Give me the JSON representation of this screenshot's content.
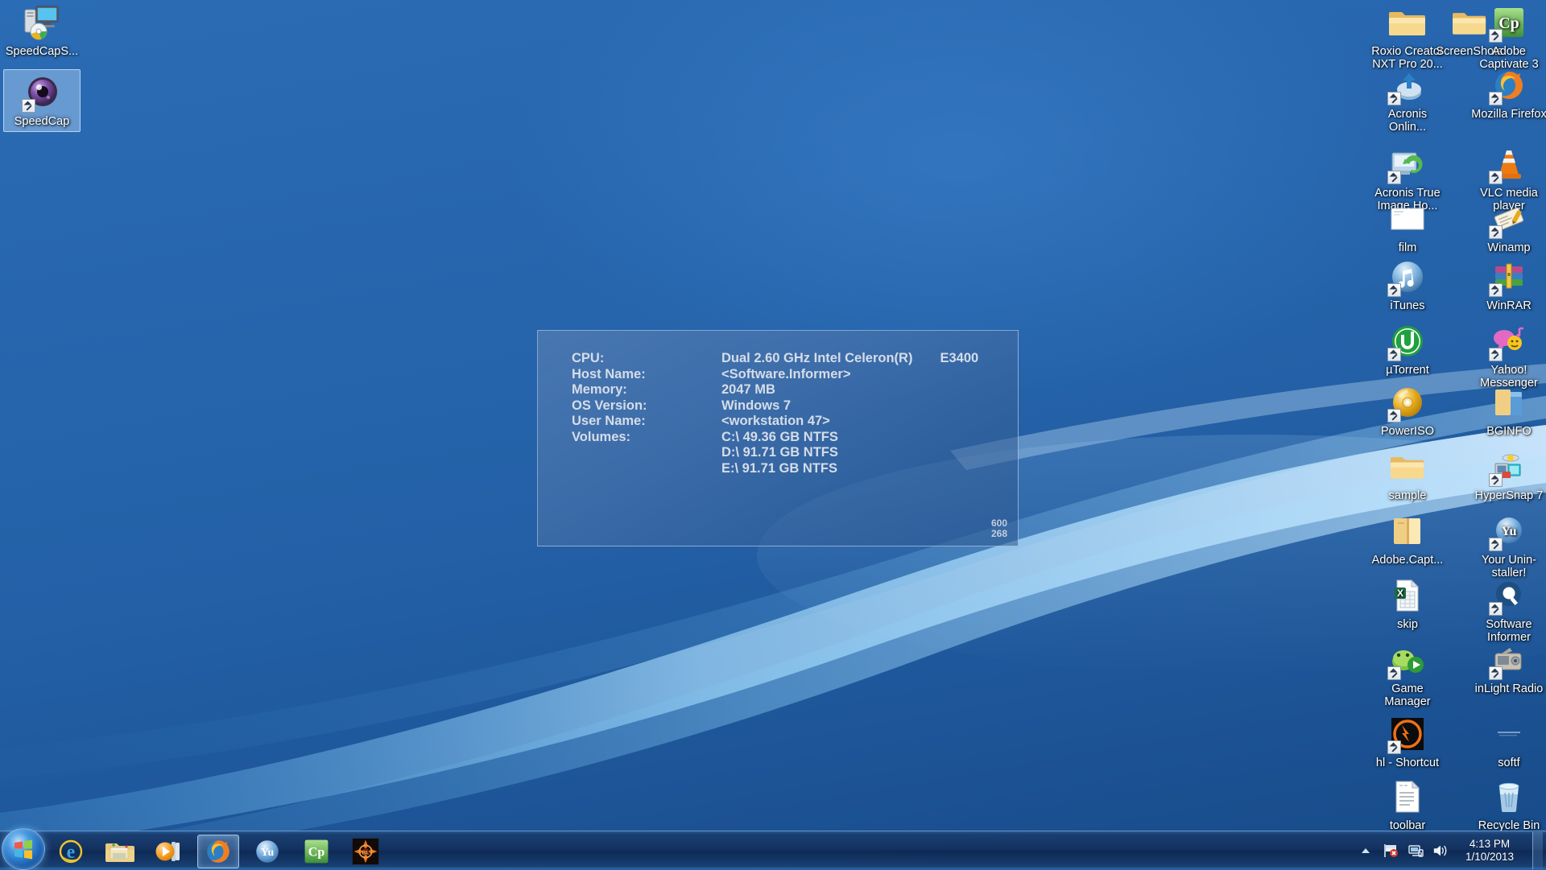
{
  "desktop": {
    "wallpaper_name": "windows-7-harmony-blue",
    "colors": {
      "wallpaper_top": "#2a6cb5",
      "wallpaper_bottom": "#174a87",
      "taskbar": "#12305e",
      "selection": "#b4d4f5",
      "bginfo_text": "#d6dde8"
    },
    "icons_left": [
      {
        "name": "SpeedCapS...",
        "icon": "computer-media-icon",
        "selected": false,
        "shortcut": false
      },
      {
        "name": "SpeedCap",
        "icon": "camera-lens-icon",
        "selected": true,
        "shortcut": true
      }
    ],
    "icons_right_col1": [
      {
        "name": "Roxio Creator NXT Pro 20...",
        "icon": "folder-icon",
        "shortcut": false
      },
      {
        "name": "Acronis Onlin...",
        "icon": "acronis-backup-icon",
        "shortcut": true
      },
      {
        "name": "Acronis True Image Ho...",
        "icon": "acronis-true-image-icon",
        "shortcut": true
      },
      {
        "name": "film",
        "icon": "blank-document-icon",
        "shortcut": false
      },
      {
        "name": "iTunes",
        "icon": "itunes-icon",
        "shortcut": true
      },
      {
        "name": "µTorrent",
        "icon": "utorrent-icon",
        "shortcut": true
      },
      {
        "name": "PowerISO",
        "icon": "disc-icon",
        "shortcut": true
      },
      {
        "name": "sample",
        "icon": "folder-icon",
        "shortcut": false
      },
      {
        "name": "Adobe.Capt...",
        "icon": "folder-open-icon",
        "shortcut": false
      },
      {
        "name": "skip",
        "icon": "excel-document-icon",
        "shortcut": false
      },
      {
        "name": "Game Manager",
        "icon": "game-manager-icon",
        "shortcut": true
      },
      {
        "name": "hl - Shortcut",
        "icon": "half-life-icon",
        "shortcut": true
      },
      {
        "name": "toolbar",
        "icon": "text-document-icon",
        "shortcut": false
      }
    ],
    "icons_right_col2": [
      {
        "name": "ScreenShots",
        "icon": "folder-icon",
        "shortcut": false
      },
      {
        "name": "Adobe Captivate 3",
        "icon": "adobe-captivate-icon",
        "shortcut": true
      },
      {
        "name": "Mozilla Firefox",
        "icon": "firefox-icon",
        "shortcut": true
      },
      {
        "name": "VLC media player",
        "icon": "vlc-cone-icon",
        "shortcut": true
      },
      {
        "name": "Winamp",
        "icon": "winamp-icon",
        "shortcut": true
      },
      {
        "name": "WinRAR",
        "icon": "winrar-icon",
        "shortcut": true
      },
      {
        "name": "Yahoo! Messenger",
        "icon": "yahoo-messenger-icon",
        "shortcut": true
      },
      {
        "name": "BGINFO",
        "icon": "folder-blue-icon",
        "shortcut": false
      },
      {
        "name": "HyperSnap 7",
        "icon": "hypersnap-icon",
        "shortcut": true
      },
      {
        "name": "Your Unin-staller!",
        "icon": "your-uninstaller-icon",
        "shortcut": true
      },
      {
        "name": "Software Informer",
        "icon": "software-informer-icon",
        "shortcut": true
      },
      {
        "name": "inLight Radio",
        "icon": "inlight-radio-icon",
        "shortcut": true
      },
      {
        "name": "softf",
        "icon": "unknown-icon",
        "shortcut": false
      },
      {
        "name": "Recycle Bin",
        "icon": "recycle-bin-icon",
        "shortcut": false
      }
    ]
  },
  "bginfo": {
    "rows": [
      {
        "label": "CPU:",
        "value": "Dual 2.60 GHz Intel Celeron(R)",
        "value2": "E3400"
      },
      {
        "label": "Host Name:",
        "value": "<Software.Informer>",
        "value2": ""
      },
      {
        "label": "Memory:",
        "value": "2047 MB",
        "value2": ""
      },
      {
        "label": "OS Version:",
        "value": "Windows 7",
        "value2": ""
      },
      {
        "label": "User Name:",
        "value": "<workstation 47>",
        "value2": ""
      },
      {
        "label": "Volumes:",
        "value": "C:\\ 49.36 GB NTFS",
        "value2": ""
      },
      {
        "label": "",
        "value": "D:\\ 91.71 GB NTFS",
        "value2": ""
      },
      {
        "label": "",
        "value": "E:\\ 91.71 GB NTFS",
        "value2": ""
      }
    ],
    "corner_width": "600",
    "corner_height": "268"
  },
  "taskbar": {
    "start_label": "Start",
    "apps": [
      {
        "name": "Internet Explorer",
        "icon": "internet-explorer-icon",
        "active": false
      },
      {
        "name": "Windows Explorer",
        "icon": "windows-explorer-icon",
        "active": false
      },
      {
        "name": "Windows Media Player",
        "icon": "windows-media-player-icon",
        "active": false
      },
      {
        "name": "Mozilla Firefox",
        "icon": "firefox-icon",
        "active": true
      },
      {
        "name": "Your Uninstaller",
        "icon": "your-uninstaller-icon",
        "active": false
      },
      {
        "name": "Adobe Captivate",
        "icon": "adobe-captivate-icon",
        "active": false
      },
      {
        "name": "Game Launcher",
        "icon": "orange-compass-icon",
        "active": false
      }
    ],
    "tray": [
      {
        "name": "Show hidden icons",
        "icon": "chevron-up-icon"
      },
      {
        "name": "Action Center",
        "icon": "flag-error-icon"
      },
      {
        "name": "Network",
        "icon": "network-icon"
      },
      {
        "name": "Volume",
        "icon": "speaker-icon"
      }
    ],
    "clock": {
      "time": "4:13 PM",
      "date": "1/10/2013"
    }
  }
}
